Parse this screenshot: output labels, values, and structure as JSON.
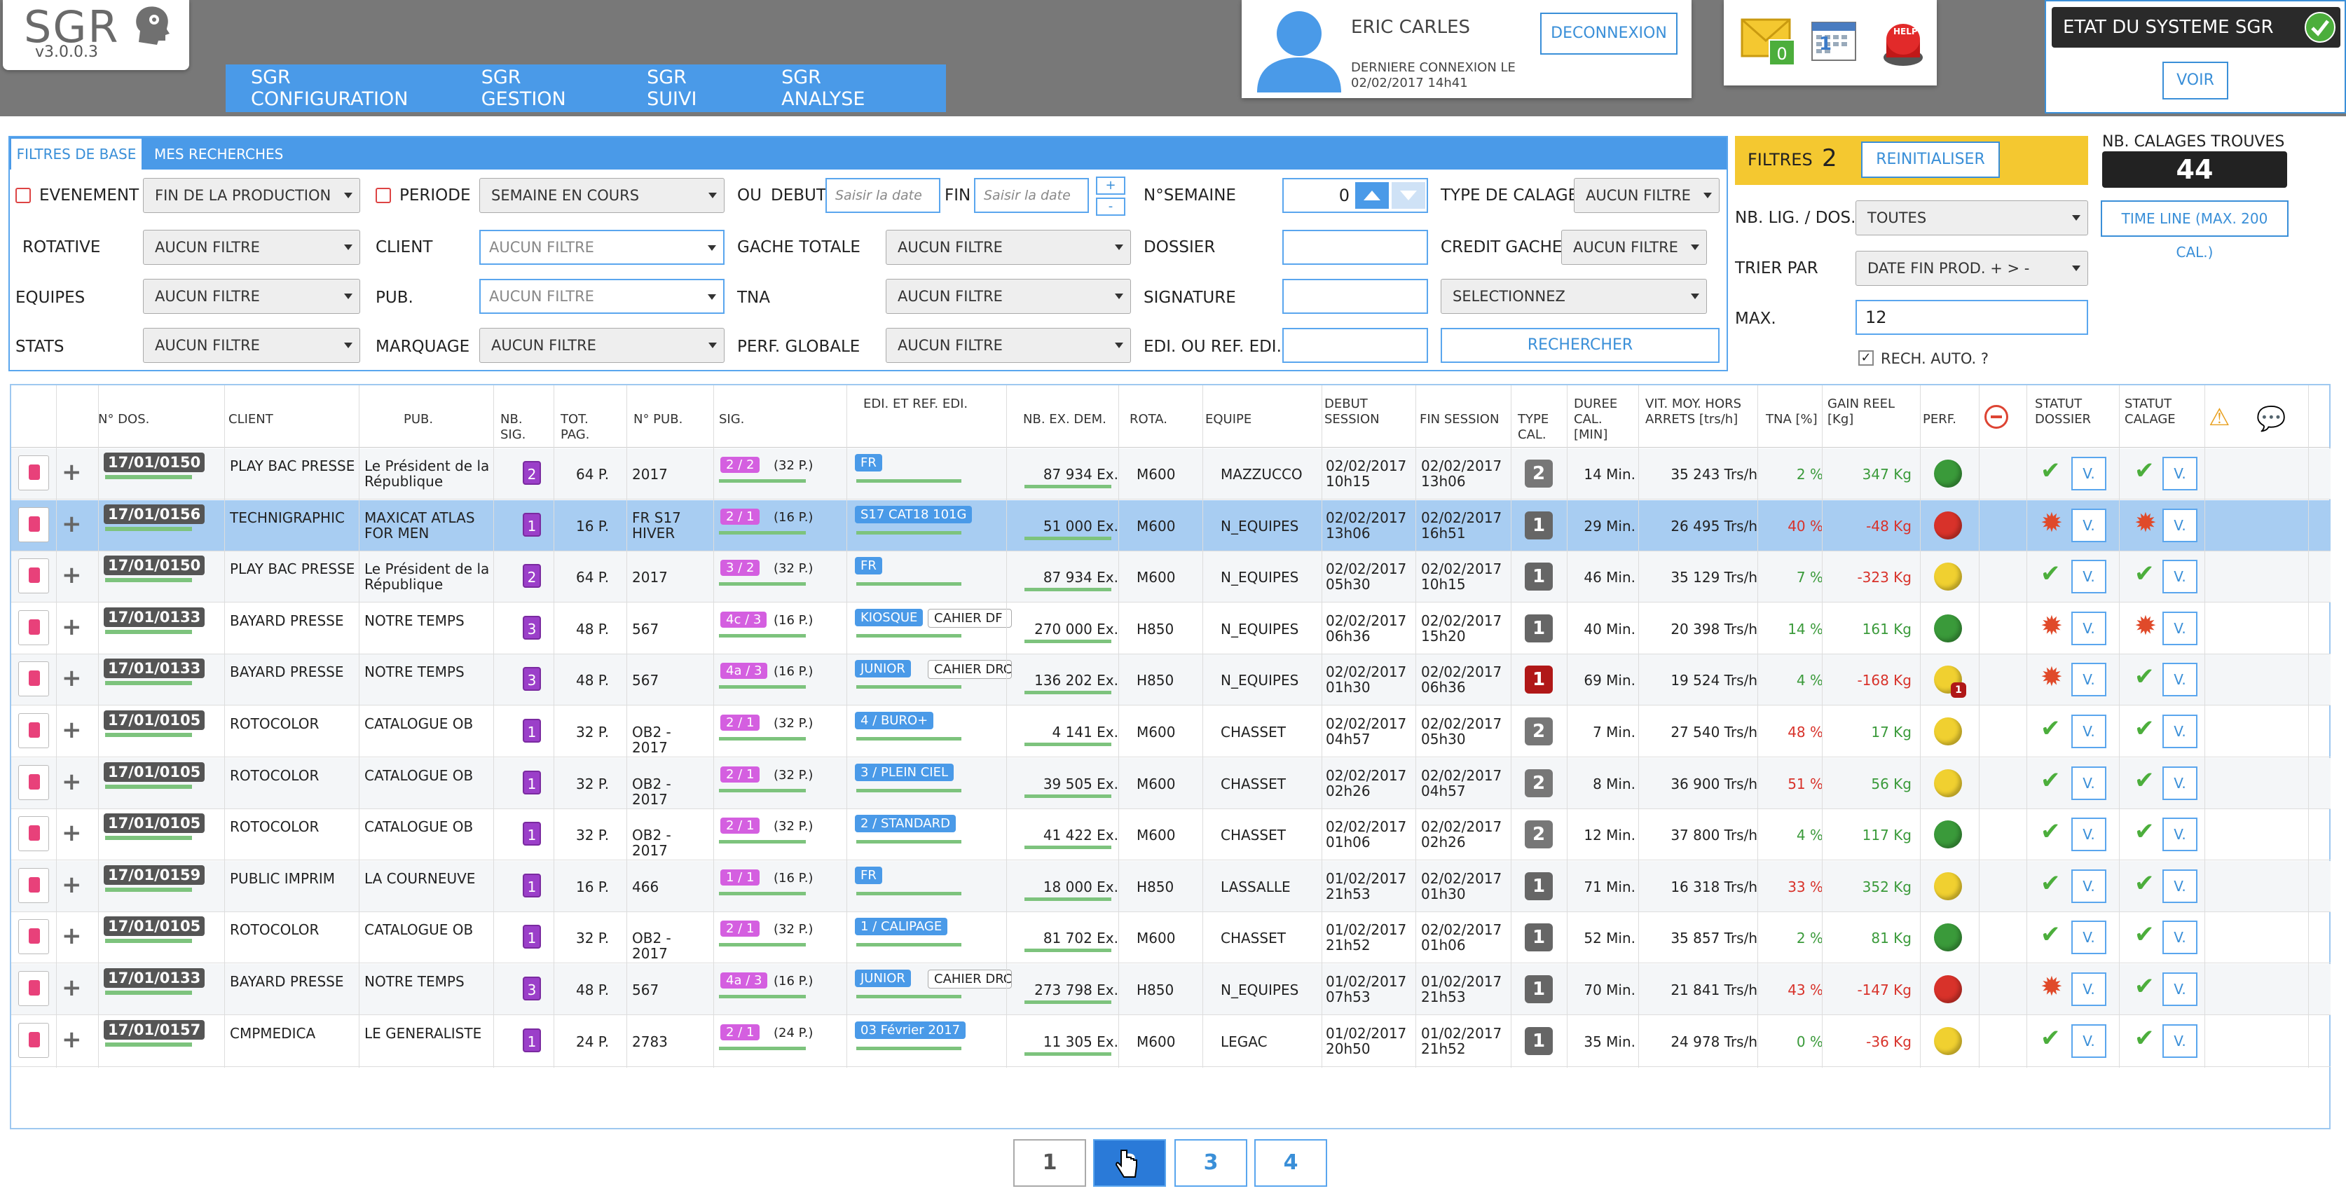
{
  "app": {
    "logo": "SGR",
    "version": "v3.0.0.3"
  },
  "nav": [
    "SGR CONFIGURATION",
    "SGR GESTION",
    "SGR SUIVI",
    "SGR ANALYSE"
  ],
  "user": {
    "name": "ERIC CARLES",
    "last_login_label": "DERNIERE CONNEXION LE",
    "last_login": "02/02/2017 14h41",
    "logout": "DECONNEXION"
  },
  "notifications": {
    "mail_count": "0",
    "calendar_day": "1",
    "help": "HELP"
  },
  "system": {
    "title": "ETAT DU SYSTEME SGR",
    "view": "VOIR"
  },
  "filters": {
    "tabs": [
      "FILTRES DE BASE",
      "MES RECHERCHES"
    ],
    "evenement": "EVENEMENT",
    "evenement_val": "FIN DE LA PRODUCTION",
    "periode": "PERIODE",
    "periode_val": "SEMAINE EN COURS",
    "ou": "OU",
    "debut": "DEBUT",
    "debut_ph": "Saisir la date",
    "fin": "FIN",
    "fin_ph": "Saisir la date",
    "plus": "+",
    "minus": "-",
    "nsemaine": "N°SEMAINE",
    "nsemaine_val": "0",
    "type_calage": "TYPE DE CALAGE",
    "type_calage_val": "AUCUN FILTRE",
    "rotative": "ROTATIVE",
    "rotative_val": "AUCUN FILTRE",
    "client": "CLIENT",
    "client_val": "AUCUN FILTRE",
    "gache_totale": "GACHE TOTALE",
    "gache_totale_val": "AUCUN FILTRE",
    "dossier": "DOSSIER",
    "credit_gache": "CREDIT GACHE",
    "credit_gache_val": "AUCUN FILTRE",
    "equipes": "EQUIPES",
    "equipes_val": "AUCUN FILTRE",
    "pub": "PUB.",
    "pub_val": "AUCUN FILTRE",
    "tna": "TNA",
    "tna_val": "AUCUN FILTRE",
    "signature": "SIGNATURE",
    "signature_val": "SELECTIONNEZ",
    "stats": "STATS",
    "stats_val": "AUCUN FILTRE",
    "marquage": "MARQUAGE",
    "marquage_val": "AUCUN FILTRE",
    "perf_globale": "PERF. GLOBALE",
    "perf_globale_val": "AUCUN FILTRE",
    "edi": "EDI. OU REF. EDI.",
    "rechercher": "RECHERCHER"
  },
  "right": {
    "filtres": "FILTRES",
    "filtres_count": "2",
    "reinit": "REINITIALISER",
    "nb_calages_label": "NB. CALAGES TROUVES",
    "nb_calages": "44",
    "nb_lig": "NB. LIG. / DOS.",
    "nb_lig_val": "TOUTES",
    "timeline": "TIME LINE (MAX. 200 CAL.)",
    "trier": "TRIER PAR",
    "trier_val": "DATE FIN PROD. + > -",
    "max": "MAX.",
    "max_val": "12",
    "rech_auto": "RECH. AUTO. ?"
  },
  "columns": [
    "N° DOS.",
    "CLIENT",
    "PUB.",
    "NB. SIG.",
    "TOT. PAG.",
    "N° PUB.",
    "SIG.",
    "EDI. ET REF. EDI.",
    "NB. EX. DEM.",
    "ROTA.",
    "EQUIPE",
    "DEBUT SESSION",
    "FIN SESSION",
    "TYPE CAL.",
    "DUREE CAL. [MIN]",
    "VIT. MOY. HORS ARRETS [trs/h]",
    "TNA [%]",
    "GAIN REEL [Kg]",
    "PERF.",
    "",
    "STATUT DOSSIER",
    "STATUT CALAGE"
  ],
  "colors": {
    "primary": "#4a9ae8",
    "green": "#4cae3c",
    "red": "#e04a2a",
    "purple": "#9b3fc9",
    "yellow": "#f4c830"
  },
  "rows": [
    {
      "dos": "17/01/0150",
      "client": "PLAY BAC PRESSE",
      "pub": "Le Président de la République",
      "nbsig": "2",
      "totpag": "64 P.",
      "npub": "2017",
      "sig": "2 / 2",
      "sigp": "(32 P.)",
      "edi": "FR",
      "edi2": "",
      "ex": "87 934 Ex.",
      "rota": "M600",
      "equipe": "MAZZUCCO",
      "debut": "02/02/2017 10h15",
      "fin": "02/02/2017 13h06",
      "typecal": "2",
      "duree": "14 Min.",
      "vit": "35 243 Trs/h",
      "tna": "2 %",
      "gain": "347 Kg",
      "perf": "green",
      "sd": "ok",
      "sc": "ok",
      "v": "V."
    },
    {
      "dos": "17/01/0156",
      "client": "TECHNIGRAPHIC",
      "pub": "MAXICAT ATLAS FOR MEN",
      "nbsig": "1",
      "totpag": "16 P.",
      "npub": "FR S17 HIVER",
      "sig": "2 / 1",
      "sigp": "(16 P.)",
      "edi": "S17 CAT18 101G",
      "edi2": "",
      "ex": "51 000 Ex.",
      "rota": "M600",
      "equipe": "N_EQUIPES",
      "debut": "02/02/2017 13h06",
      "fin": "02/02/2017 16h51",
      "typecal": "1",
      "duree": "29 Min.",
      "vit": "26 495 Trs/h",
      "tna": "40 %",
      "gain": "-48 Kg",
      "perf": "red",
      "sd": "err",
      "sc": "err",
      "v": "V."
    },
    {
      "dos": "17/01/0150",
      "client": "PLAY BAC PRESSE",
      "pub": "Le Président de la République",
      "nbsig": "2",
      "totpag": "64 P.",
      "npub": "2017",
      "sig": "3 / 2",
      "sigp": "(32 P.)",
      "edi": "FR",
      "edi2": "",
      "ex": "87 934 Ex.",
      "rota": "M600",
      "equipe": "N_EQUIPES",
      "debut": "02/02/2017 05h30",
      "fin": "02/02/2017 10h15",
      "typecal": "1",
      "duree": "46 Min.",
      "vit": "35 129 Trs/h",
      "tna": "7 %",
      "gain": "-323 Kg",
      "perf": "yellow",
      "sd": "ok",
      "sc": "ok",
      "v": "V."
    },
    {
      "dos": "17/01/0133",
      "client": "BAYARD PRESSE",
      "pub": "NOTRE TEMPS",
      "nbsig": "3",
      "totpag": "48 P.",
      "npub": "567",
      "sig": "4c / 3",
      "sigp": "(16 P.)",
      "edi": "KIOSQUE",
      "edi2": "CAHIER DF",
      "ex": "270 000 Ex.",
      "rota": "H850",
      "equipe": "N_EQUIPES",
      "debut": "02/02/2017 06h36",
      "fin": "02/02/2017 15h20",
      "typecal": "1",
      "duree": "40 Min.",
      "vit": "20 398 Trs/h",
      "tna": "14 %",
      "gain": "161 Kg",
      "perf": "green",
      "sd": "err",
      "sc": "err",
      "v": "V."
    },
    {
      "dos": "17/01/0133",
      "client": "BAYARD PRESSE",
      "pub": "NOTRE TEMPS",
      "nbsig": "3",
      "totpag": "48 P.",
      "npub": "567",
      "sig": "4a / 3",
      "sigp": "(16 P.)",
      "edi": "JUNIOR",
      "edi2": "CAHIER DRC",
      "ex": "136 202 Ex.",
      "rota": "H850",
      "equipe": "N_EQUIPES",
      "debut": "02/02/2017 01h30",
      "fin": "02/02/2017 06h36",
      "typecal": "1r",
      "duree": "69 Min.",
      "vit": "19 524 Trs/h",
      "tna": "4 %",
      "gain": "-168 Kg",
      "perf": "yellow1",
      "sd": "err",
      "sc": "ok",
      "v": "V."
    },
    {
      "dos": "17/01/0105",
      "client": "ROTOCOLOR",
      "pub": "CATALOGUE OB",
      "nbsig": "1",
      "totpag": "32 P.",
      "npub": "OB2 - 2017",
      "sig": "2 / 1",
      "sigp": "(32 P.)",
      "edi": "4 / BURO+",
      "edi2": "",
      "ex": "4 141 Ex.",
      "rota": "M600",
      "equipe": "CHASSET",
      "debut": "02/02/2017 04h57",
      "fin": "02/02/2017 05h30",
      "typecal": "2",
      "duree": "7 Min.",
      "vit": "27 540 Trs/h",
      "tna": "48 %",
      "gain": "17 Kg",
      "perf": "yellow",
      "sd": "ok",
      "sc": "ok",
      "v": "V."
    },
    {
      "dos": "17/01/0105",
      "client": "ROTOCOLOR",
      "pub": "CATALOGUE OB",
      "nbsig": "1",
      "totpag": "32 P.",
      "npub": "OB2 - 2017",
      "sig": "2 / 1",
      "sigp": "(32 P.)",
      "edi": "3 / PLEIN CIEL",
      "edi2": "",
      "ex": "39 505 Ex.",
      "rota": "M600",
      "equipe": "CHASSET",
      "debut": "02/02/2017 02h26",
      "fin": "02/02/2017 04h57",
      "typecal": "2",
      "duree": "8 Min.",
      "vit": "36 900 Trs/h",
      "tna": "51 %",
      "gain": "56 Kg",
      "perf": "yellow",
      "sd": "ok",
      "sc": "ok",
      "v": "V."
    },
    {
      "dos": "17/01/0105",
      "client": "ROTOCOLOR",
      "pub": "CATALOGUE OB",
      "nbsig": "1",
      "totpag": "32 P.",
      "npub": "OB2 - 2017",
      "sig": "2 / 1",
      "sigp": "(32 P.)",
      "edi": "2 / STANDARD",
      "edi2": "",
      "ex": "41 422 Ex.",
      "rota": "M600",
      "equipe": "CHASSET",
      "debut": "02/02/2017 01h06",
      "fin": "02/02/2017 02h26",
      "typecal": "2",
      "duree": "12 Min.",
      "vit": "37 800 Trs/h",
      "tna": "4 %",
      "gain": "117 Kg",
      "perf": "green",
      "sd": "ok",
      "sc": "ok",
      "v": "V."
    },
    {
      "dos": "17/01/0159",
      "client": "PUBLIC IMPRIM",
      "pub": "LA COURNEUVE",
      "nbsig": "1",
      "totpag": "16 P.",
      "npub": "466",
      "sig": "1 / 1",
      "sigp": "(16 P.)",
      "edi": "FR",
      "edi2": "",
      "ex": "18 000 Ex.",
      "rota": "H850",
      "equipe": "LASSALLE",
      "debut": "01/02/2017 21h53",
      "fin": "02/02/2017 01h30",
      "typecal": "1",
      "duree": "71 Min.",
      "vit": "16 318 Trs/h",
      "tna": "33 %",
      "gain": "352 Kg",
      "perf": "yellow",
      "sd": "ok",
      "sc": "ok",
      "v": "V."
    },
    {
      "dos": "17/01/0105",
      "client": "ROTOCOLOR",
      "pub": "CATALOGUE OB",
      "nbsig": "1",
      "totpag": "32 P.",
      "npub": "OB2 - 2017",
      "sig": "2 / 1",
      "sigp": "(32 P.)",
      "edi": "1 / CALIPAGE",
      "edi2": "",
      "ex": "81 702 Ex.",
      "rota": "M600",
      "equipe": "CHASSET",
      "debut": "01/02/2017 21h52",
      "fin": "02/02/2017 01h06",
      "typecal": "1",
      "duree": "52 Min.",
      "vit": "35 857 Trs/h",
      "tna": "2 %",
      "gain": "81 Kg",
      "perf": "green",
      "sd": "ok",
      "sc": "ok",
      "v": "V."
    },
    {
      "dos": "17/01/0133",
      "client": "BAYARD PRESSE",
      "pub": "NOTRE TEMPS",
      "nbsig": "3",
      "totpag": "48 P.",
      "npub": "567",
      "sig": "4a / 3",
      "sigp": "(16 P.)",
      "edi": "JUNIOR",
      "edi2": "CAHIER DRC",
      "ex": "273 798 Ex.",
      "rota": "H850",
      "equipe": "N_EQUIPES",
      "debut": "01/02/2017 07h53",
      "fin": "01/02/2017 21h53",
      "typecal": "1",
      "duree": "70 Min.",
      "vit": "21 841 Trs/h",
      "tna": "43 %",
      "gain": "-147 Kg",
      "perf": "red",
      "sd": "err",
      "sc": "ok",
      "v": "V."
    },
    {
      "dos": "17/01/0157",
      "client": "CMPMEDICA",
      "pub": "LE GENERALISTE",
      "nbsig": "1",
      "totpag": "24 P.",
      "npub": "2783",
      "sig": "2 / 1",
      "sigp": "(24 P.)",
      "edi": "03 Février 2017",
      "edi2": "",
      "ex": "11 305 Ex.",
      "rota": "M600",
      "equipe": "LEGAC",
      "debut": "01/02/2017 20h50",
      "fin": "01/02/2017 21h52",
      "typecal": "1",
      "duree": "35 Min.",
      "vit": "24 978 Trs/h",
      "tna": "0 %",
      "gain": "-36 Kg",
      "perf": "yellow",
      "sd": "ok",
      "sc": "ok",
      "v": "V."
    }
  ],
  "pagination": [
    "1",
    "2",
    "3",
    "4"
  ]
}
